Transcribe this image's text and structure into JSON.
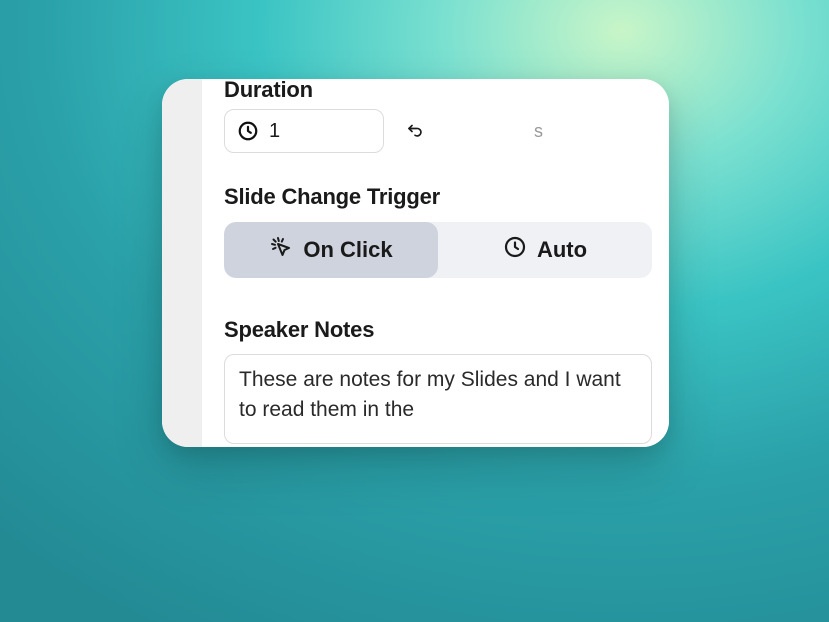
{
  "duration": {
    "label": "Duration",
    "value": "1",
    "unit": "s"
  },
  "trigger": {
    "label": "Slide Change Trigger",
    "options": {
      "click": "On Click",
      "auto": "Auto"
    },
    "active": "click"
  },
  "notes": {
    "label": "Speaker Notes",
    "text": "These are notes for my Slides and I want to read them in the"
  }
}
